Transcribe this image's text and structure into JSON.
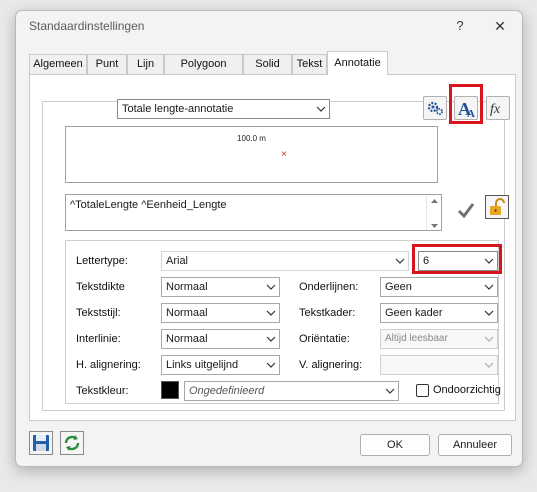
{
  "window": {
    "title": "Standaardinstellingen",
    "help": "?",
    "close": "✕"
  },
  "tabs": [
    "Algemeen",
    "Punt",
    "Lijn",
    "Polygoon",
    "Solid",
    "Tekst",
    "Annotatie"
  ],
  "annotation_type": {
    "value": "Totale lengte-annotatie"
  },
  "preview": {
    "label": "100.0 m",
    "marker": "×"
  },
  "expression": {
    "value": "^TotaleLengte ^Eenheid_Lengte"
  },
  "font": {
    "lettertype_label": "Lettertype:",
    "lettertype_value": "Arial",
    "size_value": "6",
    "tekstdikte_label": "Tekstdikte",
    "tekstdikte_value": "Normaal",
    "onderlijnen_label": "Onderlijnen:",
    "onderlijnen_value": "Geen",
    "tekststijl_label": "Tekststijl:",
    "tekststijl_value": "Normaal",
    "tekstkader_label": "Tekstkader:",
    "tekstkader_value": "Geen kader",
    "interlinie_label": "Interlinie:",
    "interlinie_value": "Normaal",
    "orientatie_label": "Oriëntatie:",
    "orientatie_value": "Altijd leesbaar",
    "h_align_label": "H. alignering:",
    "h_align_value": "Links uitgelijnd",
    "v_align_label": "V. alignering:",
    "v_align_value": "",
    "tekstkleur_label": "Tekstkleur:",
    "tekstkleur_value": "Ongedefinieerd",
    "swatch_color": "#000000",
    "transparent_label": "Ondoorzichtig"
  },
  "buttons": {
    "ok": "OK",
    "cancel": "Annuleer"
  },
  "icons": [
    "gear-settings-icon",
    "text-style-icon",
    "function-fx-icon",
    "checkmark-icon",
    "lock-icon",
    "save-icon",
    "refresh-icon"
  ],
  "colors": {
    "highlight": "#d8141c",
    "accent_blue": "#1f4e9c"
  }
}
